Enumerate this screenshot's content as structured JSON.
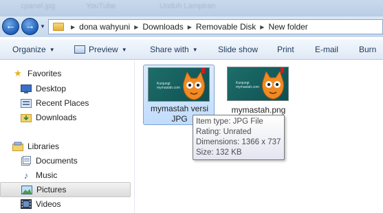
{
  "window": {
    "background_tabs": [
      "cpanel.jpg",
      "YouTube",
      "Unduh Lampiran"
    ]
  },
  "address_bar": {
    "breadcrumbs": [
      "dona wahyuni",
      "Downloads",
      "Removable Disk",
      "New folder"
    ],
    "back_icon": "back-arrow-icon",
    "forward_icon": "forward-arrow-icon"
  },
  "toolbar": {
    "organize": "Organize",
    "preview": "Preview",
    "share_with": "Share with",
    "slide_show": "Slide show",
    "print": "Print",
    "email": "E-mail",
    "burn": "Burn"
  },
  "nav": {
    "favorites": {
      "header": "Favorites",
      "items": [
        "Desktop",
        "Recent Places",
        "Downloads"
      ]
    },
    "libraries": {
      "header": "Libraries",
      "items": [
        "Documents",
        "Music",
        "Pictures",
        "Videos"
      ],
      "selected": "Pictures"
    }
  },
  "files": [
    {
      "name": "mymastah versi JPG",
      "selected": true,
      "thumb_text": "Kunjungi mymastah.com"
    },
    {
      "name": "mymastah.png",
      "selected": false,
      "thumb_text": "Kunjungi mymastah.com"
    }
  ],
  "tooltip": {
    "type": "Item type: JPG File",
    "rating": "Rating: Unrated",
    "dimensions": "Dimensions: 1366 x 737",
    "size": "Size: 132 KB"
  },
  "colors": {
    "selection": "#c1dcfc",
    "toolbar_text": "#1e395b",
    "thumb_bg": "#1d6e6a",
    "cat_orange": "#f08a24"
  }
}
